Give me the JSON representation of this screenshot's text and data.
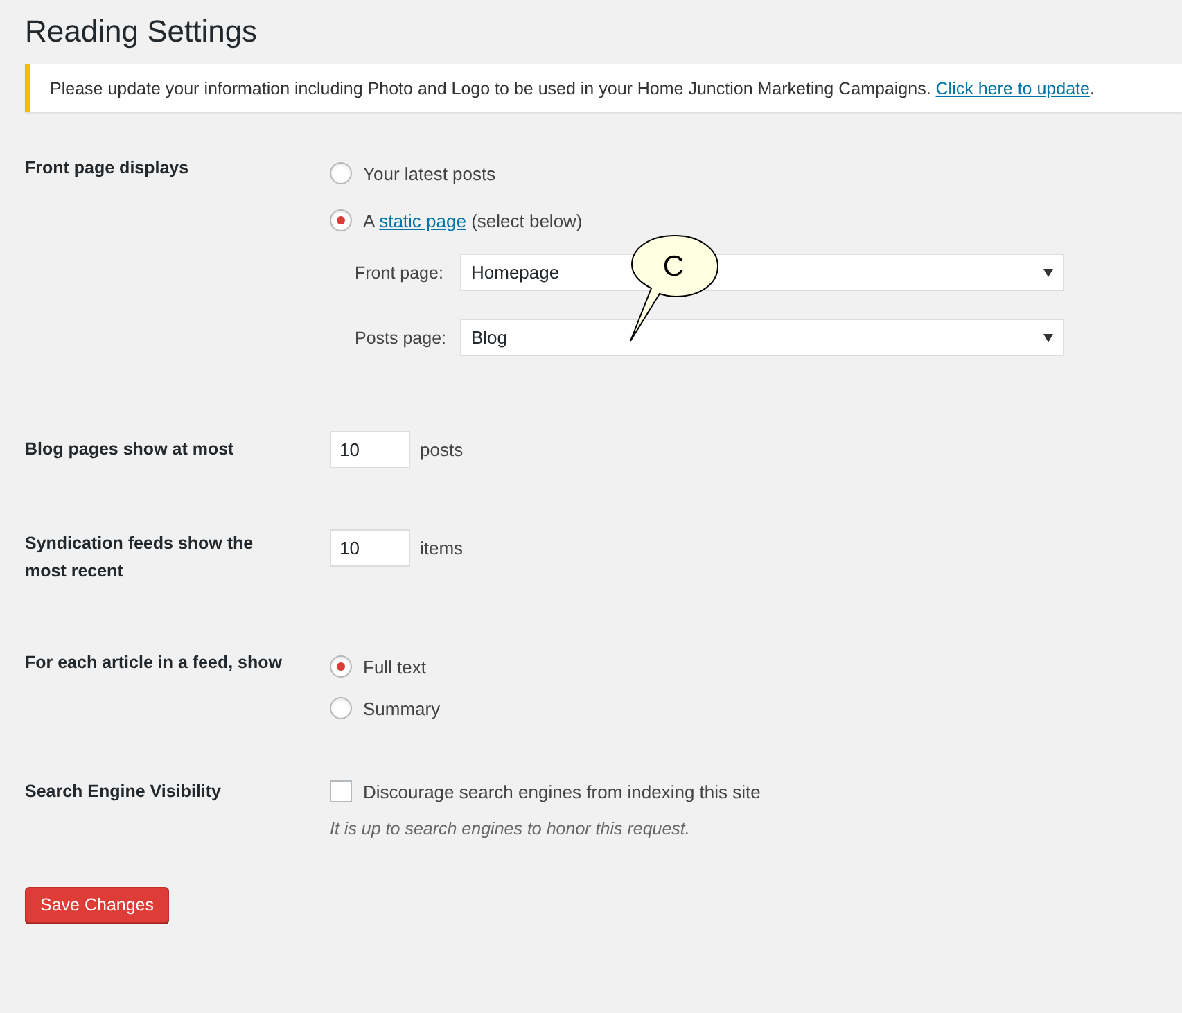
{
  "title": "Reading Settings",
  "notice": {
    "text": "Please update your information including Photo and Logo to be used in your Home Junction Marketing Campaigns.",
    "link": "Click here to update",
    "after": "."
  },
  "front_page_displays": {
    "label": "Front page displays",
    "options": [
      {
        "kind": "plain",
        "text": "Your latest posts",
        "selected": false
      },
      {
        "kind": "linked",
        "before": "A",
        "link": "static page",
        "after": "(select below)",
        "selected": true
      }
    ],
    "selects": [
      {
        "label": "Front page:",
        "value": "Homepage"
      },
      {
        "label": "Posts page:",
        "value": "Blog"
      }
    ]
  },
  "callout": {
    "text": "C"
  },
  "number_rows": [
    {
      "label": "Blog pages show at most",
      "value": "10",
      "unit": "posts"
    },
    {
      "label": "Syndication feeds show the most recent",
      "value": "10",
      "unit": "items"
    }
  ],
  "feed_article": {
    "label": "For each article in a feed, show",
    "options": [
      {
        "text": "Full text",
        "selected": true
      },
      {
        "text": "Summary",
        "selected": false
      }
    ]
  },
  "search_visibility": {
    "label": "Search Engine Visibility",
    "checkbox": {
      "text": "Discourage search engines from indexing this site",
      "checked": false
    },
    "description": "It is up to search engines to honor this request."
  },
  "save_button": "Save Changes"
}
